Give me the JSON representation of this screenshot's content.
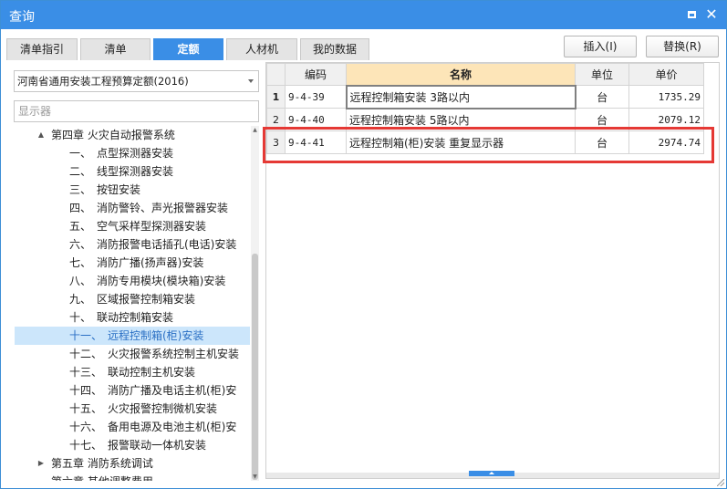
{
  "window": {
    "title": "查询"
  },
  "tabs": [
    {
      "label": "清单指引",
      "active": false
    },
    {
      "label": "清单",
      "active": false
    },
    {
      "label": "定额",
      "active": true
    },
    {
      "label": "人材机",
      "active": false
    },
    {
      "label": "我的数据",
      "active": false
    }
  ],
  "actions": {
    "insert_label": "插入(I)",
    "replace_label": "替换(R)"
  },
  "left": {
    "quota_library": "河南省通用安装工程预算定额(2016)",
    "search_placeholder": "显示器",
    "tree": [
      {
        "arrow": "▲",
        "num": "",
        "label": "第四章  火灾自动报警系统",
        "level": 1,
        "selected": false
      },
      {
        "arrow": "",
        "num": "一、",
        "label": "点型探测器安装",
        "level": 2,
        "selected": false
      },
      {
        "arrow": "",
        "num": "二、",
        "label": "线型探测器安装",
        "level": 2,
        "selected": false
      },
      {
        "arrow": "",
        "num": "三、",
        "label": "按钮安装",
        "level": 2,
        "selected": false
      },
      {
        "arrow": "",
        "num": "四、",
        "label": "消防警铃、声光报警器安装",
        "level": 2,
        "selected": false
      },
      {
        "arrow": "",
        "num": "五、",
        "label": "空气采样型探测器安装",
        "level": 2,
        "selected": false
      },
      {
        "arrow": "",
        "num": "六、",
        "label": "消防报警电话插孔(电话)安装",
        "level": 2,
        "selected": false
      },
      {
        "arrow": "",
        "num": "七、",
        "label": "消防广播(扬声器)安装",
        "level": 2,
        "selected": false
      },
      {
        "arrow": "",
        "num": "八、",
        "label": "消防专用模块(模块箱)安装",
        "level": 2,
        "selected": false
      },
      {
        "arrow": "",
        "num": "九、",
        "label": "区域报警控制箱安装",
        "level": 2,
        "selected": false
      },
      {
        "arrow": "",
        "num": "十、",
        "label": "联动控制箱安装",
        "level": 2,
        "selected": false
      },
      {
        "arrow": "",
        "num": "十一、",
        "label": "远程控制箱(柜)安装",
        "level": 2,
        "selected": true
      },
      {
        "arrow": "",
        "num": "十二、",
        "label": "火灾报警系统控制主机安装",
        "level": 2,
        "selected": false
      },
      {
        "arrow": "",
        "num": "十三、",
        "label": "联动控制主机安装",
        "level": 2,
        "selected": false
      },
      {
        "arrow": "",
        "num": "十四、",
        "label": "消防广播及电话主机(柜)安",
        "level": 2,
        "selected": false
      },
      {
        "arrow": "",
        "num": "十五、",
        "label": "火灾报警控制微机安装",
        "level": 2,
        "selected": false
      },
      {
        "arrow": "",
        "num": "十六、",
        "label": "备用电源及电池主机(柜)安",
        "level": 2,
        "selected": false
      },
      {
        "arrow": "",
        "num": "十七、",
        "label": "报警联动一体机安装",
        "level": 2,
        "selected": false
      },
      {
        "arrow": "▶",
        "num": "",
        "label": "第五章  消防系统调试",
        "level": 1,
        "selected": false
      },
      {
        "arrow": "",
        "num": "",
        "label": "第六章  其他调整费用",
        "level": 1,
        "selected": false
      }
    ]
  },
  "grid": {
    "headers": {
      "code": "编码",
      "name": "名称",
      "unit": "单位",
      "price": "单价"
    },
    "rows": [
      {
        "num": "1",
        "code": "9-4-39",
        "name": "远程控制箱安装  3路以内",
        "unit": "台",
        "price": "1735.29"
      },
      {
        "num": "2",
        "code": "9-4-40",
        "name": "远程控制箱安装  5路以内",
        "unit": "台",
        "price": "2079.12"
      },
      {
        "num": "3",
        "code": "9-4-41",
        "name": "远程控制箱(柜)安装  重复显示器",
        "unit": "台",
        "price": "2974.74"
      }
    ]
  },
  "colors": {
    "accent": "#3a8ee6",
    "highlight": "#e53935",
    "name_header": "#fde5b8",
    "selected_row": "#cce6fb"
  }
}
